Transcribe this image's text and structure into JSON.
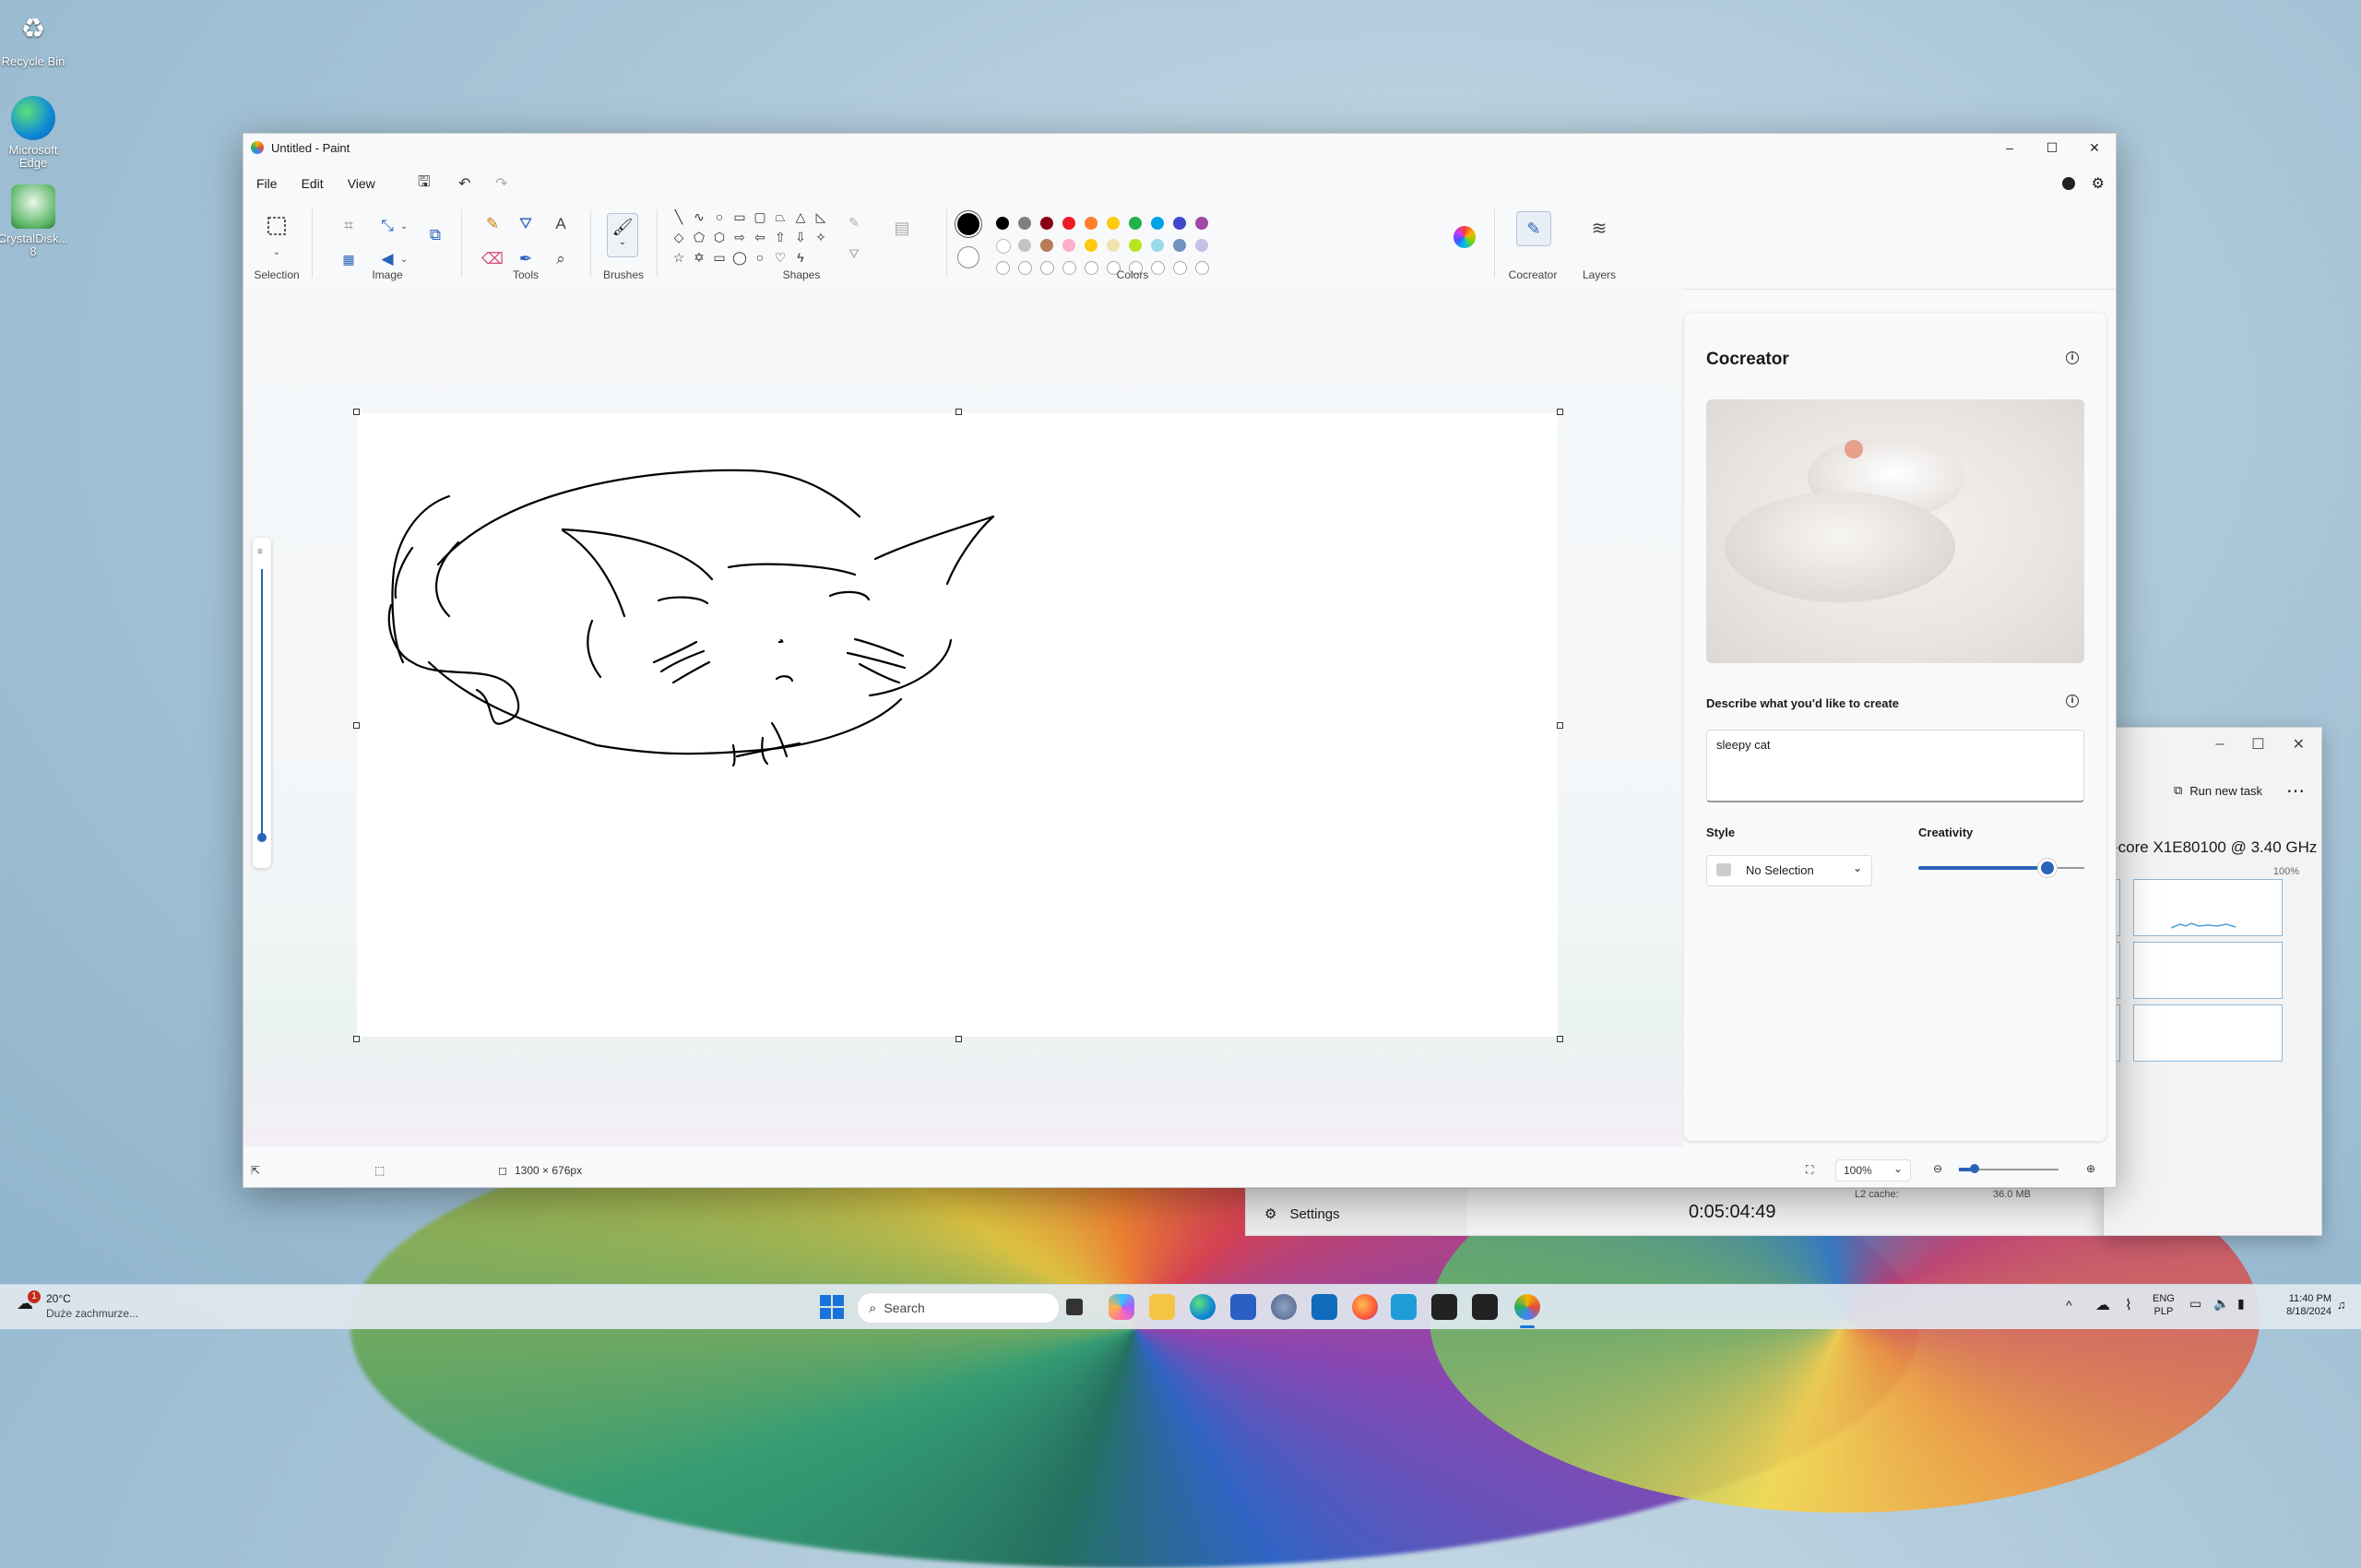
{
  "desktop": {
    "icons": [
      {
        "label": "Recycle Bin",
        "icon": "recycle-bin-icon"
      },
      {
        "label": "Microsoft Edge",
        "icon": "edge-icon"
      },
      {
        "label": "CrystalDisk... 8",
        "icon": "crystaldisk-icon"
      }
    ]
  },
  "paint": {
    "title": "Untitled - Paint",
    "menu": [
      "File",
      "Edit",
      "View"
    ],
    "groups": {
      "selection": "Selection",
      "image": "Image",
      "tools": "Tools",
      "brushes": "Brushes",
      "shapes": "Shapes",
      "colors": "Colors",
      "cocreator": "Cocreator",
      "layers": "Layers"
    },
    "palette_top": [
      "#000000",
      "#7f7f7f",
      "#880015",
      "#ed1c24",
      "#ff7f27",
      "#ffc90e",
      "#22b14c",
      "#00a2e8",
      "#3f48cc",
      "#a349a4"
    ],
    "palette_mid": [
      "#ffffff",
      "#c3c3c3",
      "#b97a57",
      "#ffaec9",
      "#ffc90e",
      "#efe4b0",
      "#b5e61d",
      "#99d9ea",
      "#7092be",
      "#c8bfe7"
    ],
    "status": {
      "canvas_size": "1300 × 676px",
      "zoom": "100%"
    },
    "cocreator": {
      "title": "Cocreator",
      "describe_label": "Describe what you'd like to create",
      "prompt_value": "sleepy cat",
      "style_label": "Style",
      "style_value": "No Selection",
      "creativity_label": "Creativity",
      "creativity_level": 0.78
    }
  },
  "task_manager": {
    "run_new_task": "Run new task",
    "cpu_name": "-core X1E80100 @ 3.40 GHz",
    "cpu_scale": "100%",
    "settings": "Settings",
    "uptime": "0:05:04:49",
    "l2_label": "L2 cache:",
    "l2_value": "36.0 MB"
  },
  "taskbar": {
    "weather_temp": "20°C",
    "weather_desc": "Duże zachmurze...",
    "weather_badge": "1",
    "search_placeholder": "Search",
    "lang": "ENG",
    "layout": "PLP",
    "time": "11:40 PM",
    "date": "8/18/2024"
  }
}
